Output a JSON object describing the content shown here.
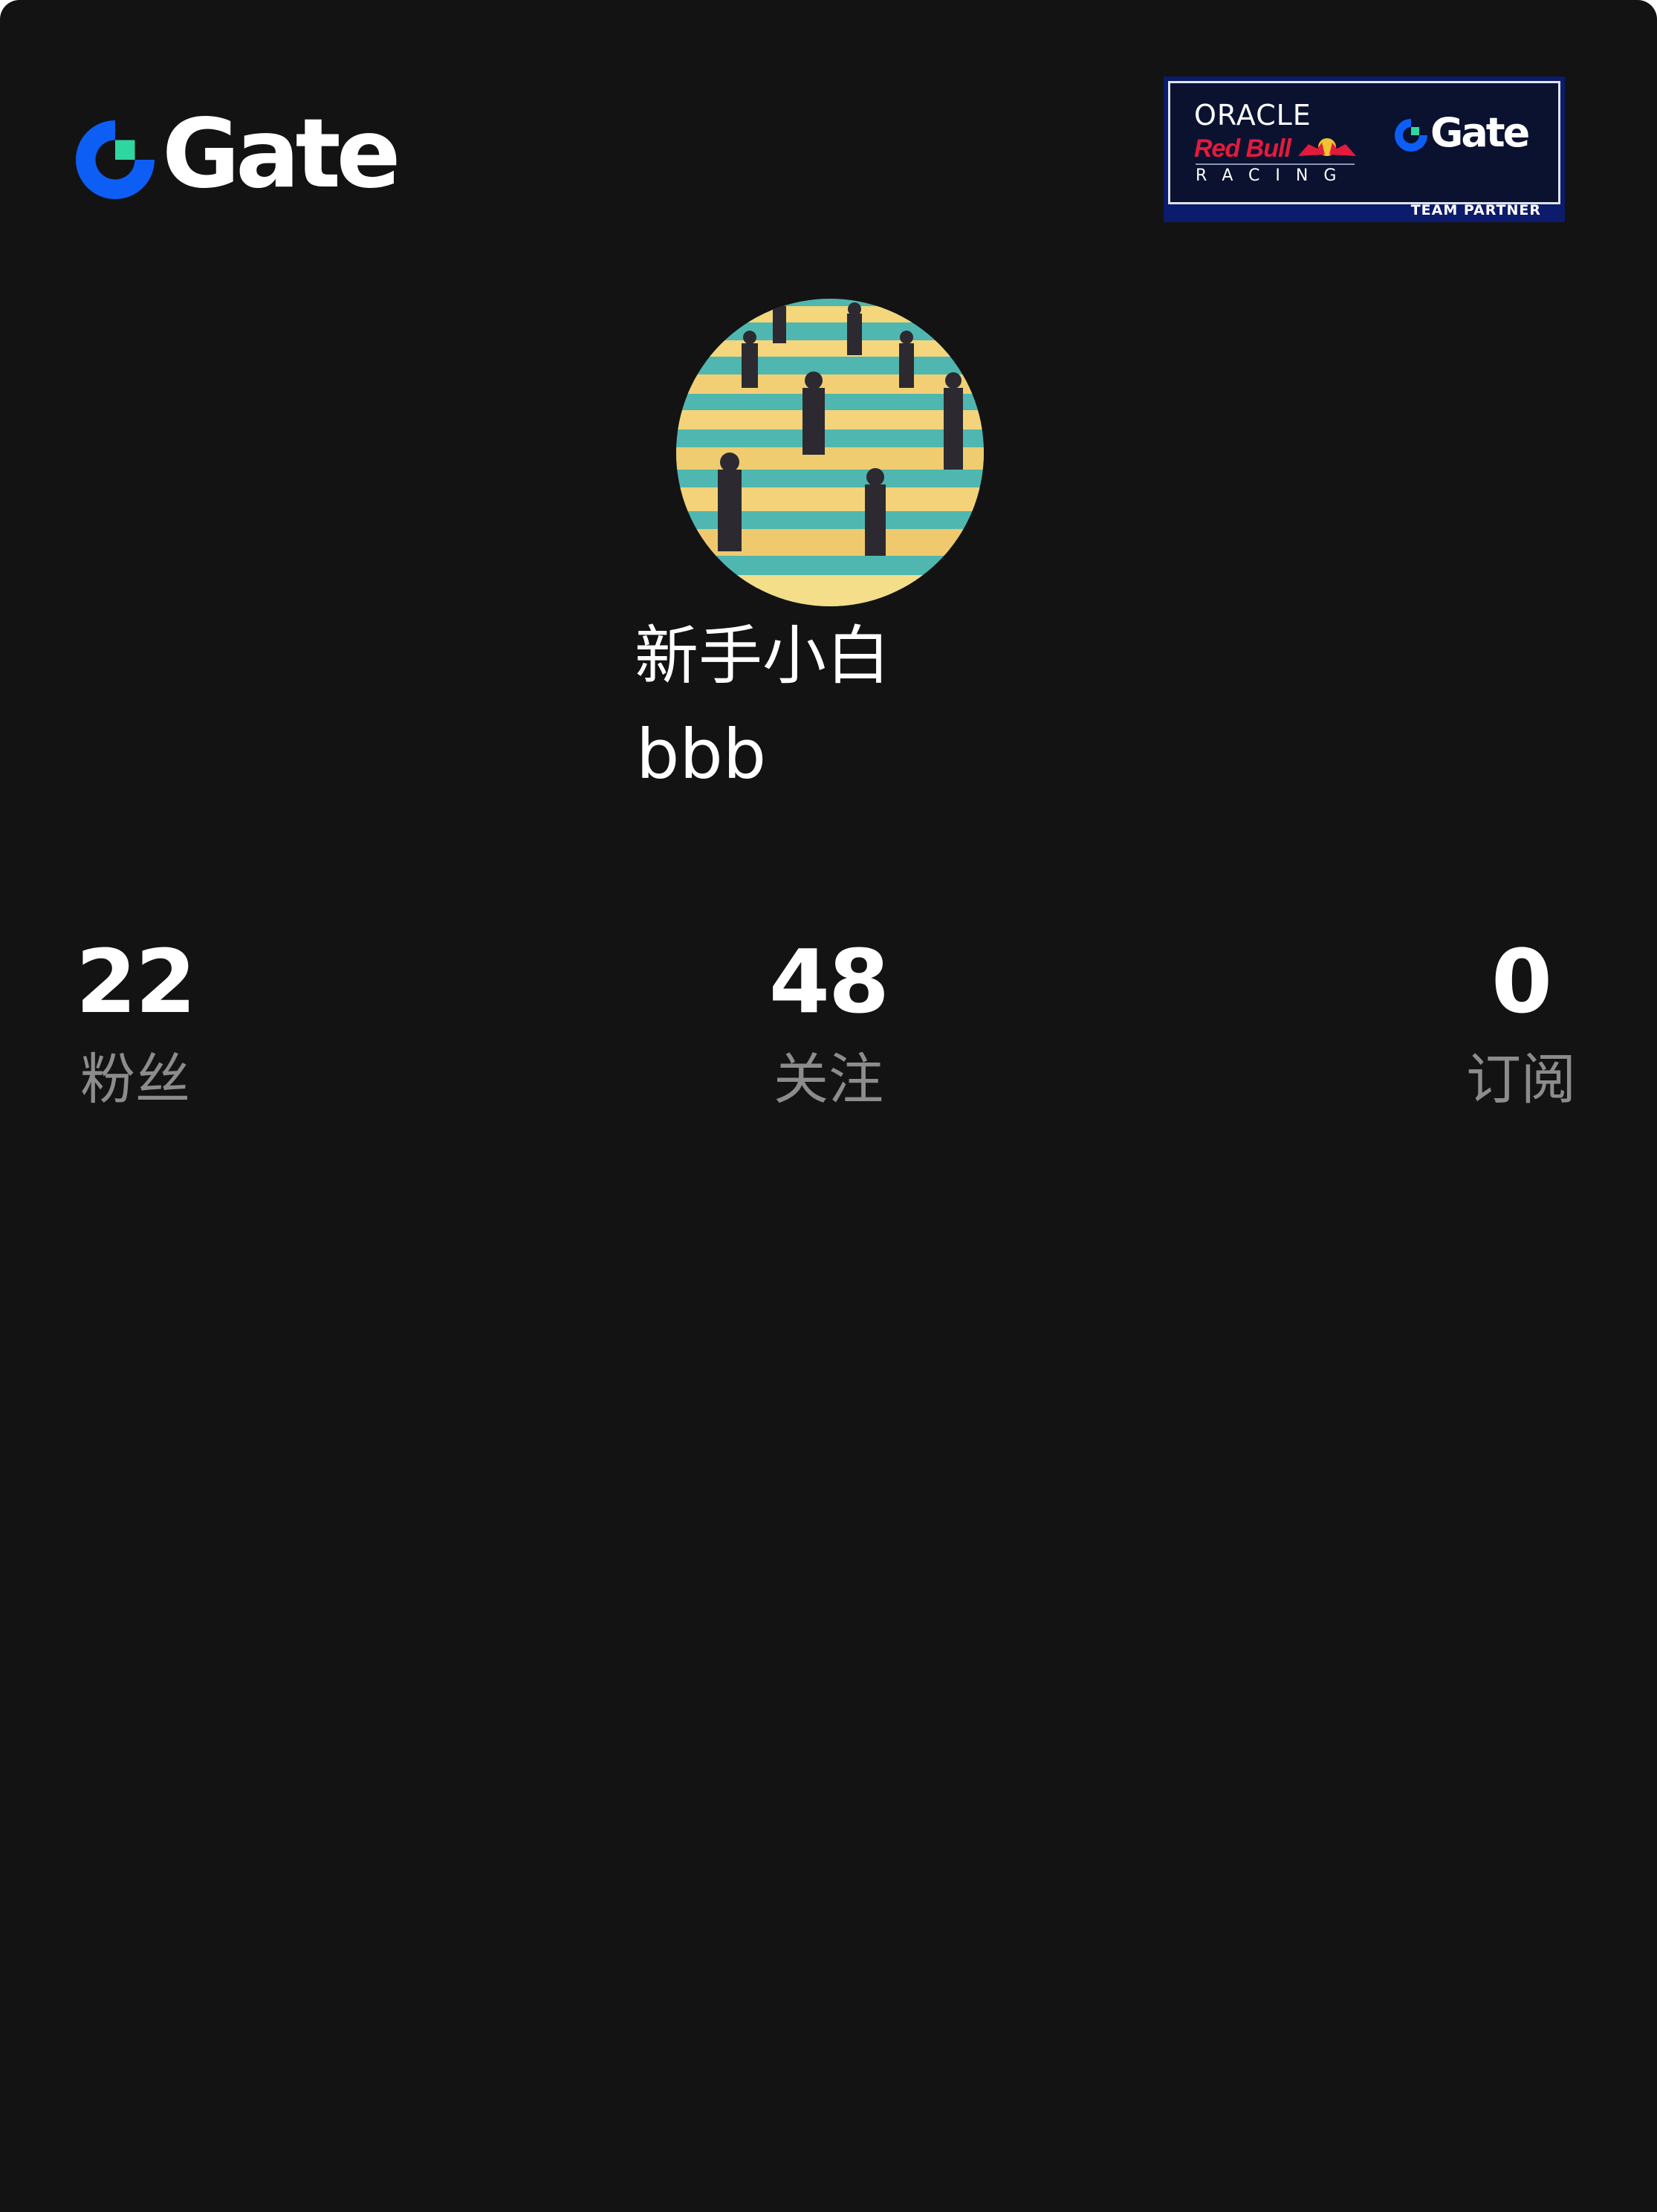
{
  "header": {
    "logo_text": "Gate",
    "partner_badge": {
      "line1": "ORACLE",
      "line2": "Red Bull",
      "line3": "RACING",
      "partner_logo_text": "Gate",
      "caption": "TEAM PARTNER"
    }
  },
  "profile": {
    "display_name": "新手小白",
    "username": "bbb"
  },
  "stats": [
    {
      "value": "22",
      "label": "粉丝"
    },
    {
      "value": "48",
      "label": "关注"
    },
    {
      "value": "0",
      "label": "订阅"
    }
  ],
  "colors": {
    "background": "#131313",
    "brand_blue": "#0d5ef5",
    "brand_green": "#2fd6a0",
    "muted_text": "#8c8c8c",
    "badge_navy": "#0c1b6b",
    "redbull_red": "#e21b3c"
  }
}
